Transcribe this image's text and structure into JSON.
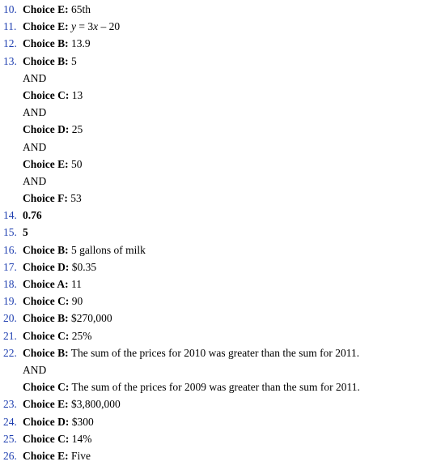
{
  "answers": [
    {
      "num": "10.",
      "label": "Choice E:",
      "value": "65th"
    },
    {
      "num": "11.",
      "label": "Choice E:",
      "value_parts": [
        "y",
        " = 3",
        "x",
        " – 20"
      ]
    },
    {
      "num": "12.",
      "label": "Choice B:",
      "value": "13.9"
    },
    {
      "num": "13.",
      "label": "Choice B:",
      "value": "5"
    },
    {
      "and": "AND"
    },
    {
      "label": "Choice C:",
      "value": "13"
    },
    {
      "and": "AND"
    },
    {
      "label": "Choice D:",
      "value": "25"
    },
    {
      "and": "AND"
    },
    {
      "label": "Choice E:",
      "value": "50"
    },
    {
      "and": "AND"
    },
    {
      "label": "Choice F:",
      "value": "53"
    },
    {
      "num": "14.",
      "bold_value": "0.76"
    },
    {
      "num": "15.",
      "bold_value": "5"
    },
    {
      "num": "16.",
      "label": "Choice B:",
      "value": "5 gallons of milk"
    },
    {
      "num": "17.",
      "label": "Choice D:",
      "value": "$0.35"
    },
    {
      "num": "18.",
      "label": "Choice A:",
      "value": "11"
    },
    {
      "num": "19.",
      "label": "Choice C:",
      "value": "90"
    },
    {
      "num": "20.",
      "label": "Choice B:",
      "value": "$270,000"
    },
    {
      "num": "21.",
      "label": "Choice C:",
      "value": "25%"
    },
    {
      "num": "22.",
      "label": "Choice B:",
      "value": "The sum of the prices for 2010 was greater than the sum for 2011."
    },
    {
      "and": "AND"
    },
    {
      "label": "Choice C:",
      "value": "The sum of the prices for 2009 was greater than the sum for 2011."
    },
    {
      "num": "23.",
      "label": "Choice E:",
      "value": "$3,800,000"
    },
    {
      "num": "24.",
      "label": "Choice D:",
      "value": "$300"
    },
    {
      "num": "25.",
      "label": "Choice C:",
      "value": "14%"
    },
    {
      "num": "26.",
      "label": "Choice E:",
      "value": "Five"
    }
  ]
}
